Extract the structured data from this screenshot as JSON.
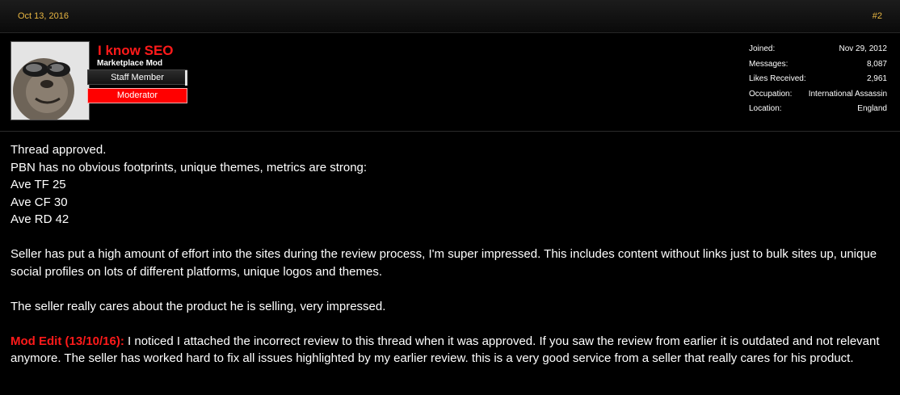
{
  "post": {
    "date": "Oct 13, 2016",
    "number": "#2"
  },
  "author": {
    "name": "I know SEO",
    "title": "Marketplace Mod",
    "staff_banner": "Staff Member",
    "role_banner": "Moderator",
    "colors": {
      "name": "#ff1a1a",
      "role_banner": "#ff0000"
    }
  },
  "stats": [
    {
      "label": "Joined:",
      "value": "Nov 29, 2012"
    },
    {
      "label": "Messages:",
      "value": "8,087"
    },
    {
      "label": "Likes Received:",
      "value": "2,961"
    },
    {
      "label": "Occupation:",
      "value": "International Assassin"
    },
    {
      "label": "Location:",
      "value": "England"
    }
  ],
  "message": {
    "lines_1": [
      "Thread approved.",
      "PBN has no obvious footprints, unique themes, metrics are strong:",
      "Ave TF 25",
      "Ave CF 30",
      "Ave RD 42"
    ],
    "para_2": "Seller has put a high amount of effort into the sites during the review process, I'm super impressed. This includes content without links just to bulk sites up, unique social profiles on lots of different platforms, unique logos and themes.",
    "para_3": "The seller really cares about the product he is selling, very impressed.",
    "mod_edit_label": "Mod Edit (13/10/16):",
    "mod_edit_text": " I noticed I attached the incorrect review to this thread when it was approved. If you saw the review from earlier it is outdated and not relevant anymore. The seller has worked hard to fix all issues highlighted by my earlier review. this is a very good service from a seller that really cares for his product."
  },
  "date_color": "#e8b642"
}
